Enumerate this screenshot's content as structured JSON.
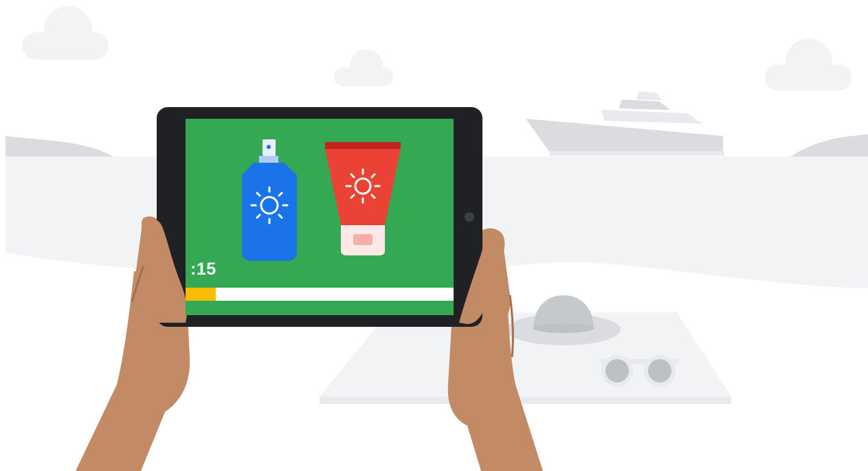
{
  "video": {
    "time_remaining": ":15",
    "progress_fraction": 0.113
  },
  "colors": {
    "screen_background": "#34a853",
    "progress_fill": "#fbbc04",
    "progress_track": "#ffffff",
    "spray_bottle": "#1a73e8",
    "lotion_tube": "#ea4335",
    "skin": "#c38a66",
    "tablet_frame": "#202124"
  },
  "scene_items": [
    "cloud-icon",
    "yacht-icon",
    "sun-hat-icon",
    "sunglasses-icon",
    "beach-towel-icon",
    "spray-sunscreen-icon",
    "sunscreen-tube-icon",
    "sun-icon"
  ]
}
